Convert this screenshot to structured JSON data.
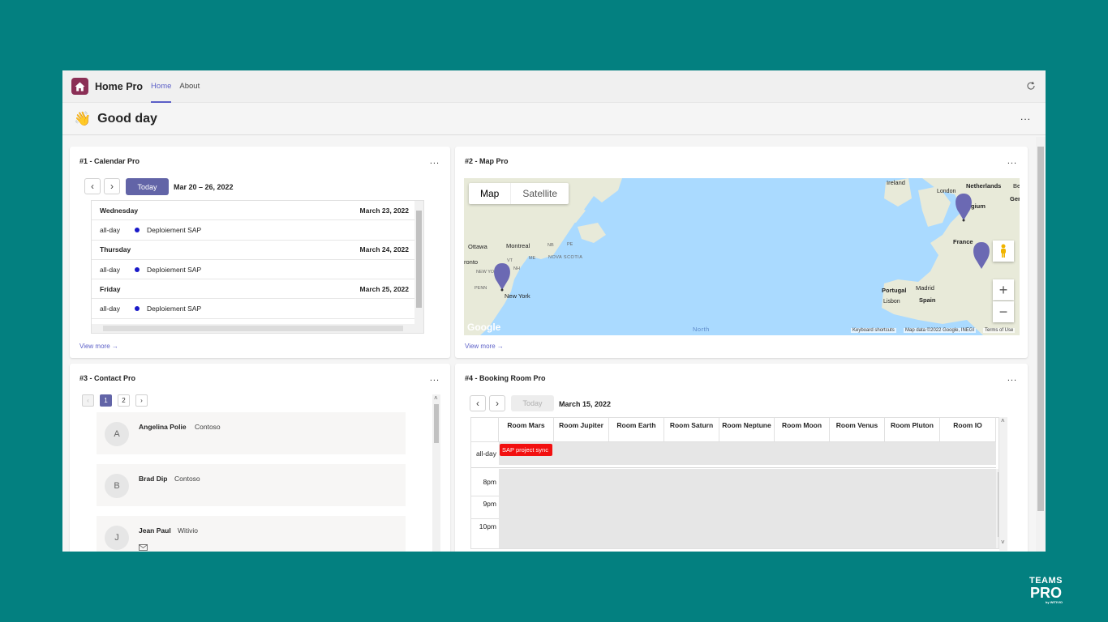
{
  "app": {
    "title": "Home Pro",
    "tabs": [
      "Home",
      "About"
    ],
    "greeting": "Good day",
    "more": "..."
  },
  "calendar": {
    "title": "#1 - Calendar Pro",
    "today": "Today",
    "range": "Mar 20 – 26, 2022",
    "days": [
      {
        "name": "Wednesday",
        "date": "March 23, 2022",
        "event_time": "all-day",
        "event": "Deploiement SAP"
      },
      {
        "name": "Thursday",
        "date": "March 24, 2022",
        "event_time": "all-day",
        "event": "Deploiement SAP"
      },
      {
        "name": "Friday",
        "date": "March 25, 2022",
        "event_time": "all-day",
        "event": "Deploiement SAP"
      }
    ],
    "view_more": "View more →"
  },
  "map": {
    "title": "#2 - Map Pro",
    "tab_map": "Map",
    "tab_satellite": "Satellite",
    "labels": {
      "ireland": "Ireland",
      "london": "London",
      "netherlands": "Netherlands",
      "be": "Be",
      "germa": "Germa",
      "gium": "gium",
      "france": "France",
      "portugal": "Portugal",
      "madrid": "Madrid",
      "spain": "Spain",
      "lisbon": "Lisbon",
      "ottawa": "Ottawa",
      "montreal": "Montreal",
      "toronto": "ronto",
      "newyork": "New York",
      "novascotia": "NOVA SCOTIA",
      "pe": "PE",
      "nb": "NB",
      "me": "ME",
      "vt": "VT",
      "nh": "NH",
      "ny": "NEW YO",
      "penn": "PENN",
      "north": "North",
      "google": "Google"
    },
    "zoom_in": "+",
    "zoom_out": "−",
    "footer_shortcuts": "Keyboard shortcuts",
    "footer_data": "Map data ©2022 Google, INEGI",
    "footer_terms": "Terms of Use",
    "view_more": "View more →",
    "colors": {
      "water": "#aadaff",
      "land": "#e8ead9",
      "pin": "#6b69b3"
    }
  },
  "contacts": {
    "title": "#3 - Contact Pro",
    "pages": [
      "1",
      "2"
    ],
    "items": [
      {
        "initial": "A",
        "name": "Angelina Polie",
        "company": "Contoso"
      },
      {
        "initial": "B",
        "name": "Brad Dip",
        "company": "Contoso"
      },
      {
        "initial": "J",
        "name": "Jean Paul",
        "company": "Witivio"
      }
    ]
  },
  "booking": {
    "title": "#4 - Booking Room Pro",
    "today": "Today",
    "date": "March 15, 2022",
    "rooms": [
      "Room Mars",
      "Room Jupiter",
      "Room Earth",
      "Room Saturn",
      "Room Neptune",
      "Room Moon",
      "Room Venus",
      "Room Pluton",
      "Room IO"
    ],
    "allday": "all-day",
    "event": "SAP project sync",
    "times": [
      "8pm",
      "9pm",
      "10pm"
    ]
  },
  "brand": {
    "line1": "TEAMS",
    "line2": "PRO",
    "line3": "by WITIVIO"
  }
}
